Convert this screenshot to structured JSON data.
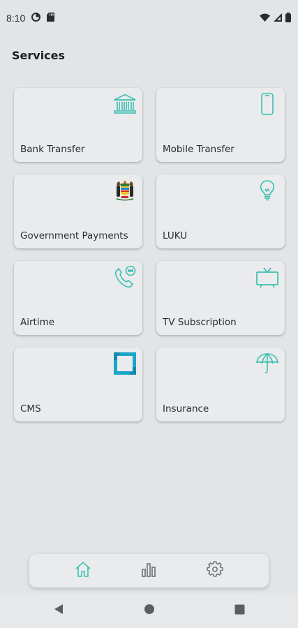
{
  "status_bar": {
    "time": "8:10",
    "left_icons": [
      "data-saver-icon",
      "sd-card-icon"
    ],
    "right_icons": [
      "wifi-icon",
      "cell-signal-icon",
      "battery-icon"
    ]
  },
  "page": {
    "title": "Services"
  },
  "services": [
    {
      "label": "Bank Transfer",
      "icon": "bank-icon"
    },
    {
      "label": "Mobile Transfer",
      "icon": "mobile-phone-icon"
    },
    {
      "label": "Government Payments",
      "icon": "coat-of-arms-icon"
    },
    {
      "label": "LUKU",
      "icon": "light-bulb-icon"
    },
    {
      "label": "Airtime",
      "icon": "phone-call-icon"
    },
    {
      "label": "TV Subscription",
      "icon": "tv-icon"
    },
    {
      "label": "CMS",
      "icon": "cms-logo-icon"
    },
    {
      "label": "Insurance",
      "icon": "umbrella-icon"
    }
  ],
  "bottom_nav": {
    "items": [
      {
        "icon": "home-icon",
        "active": true
      },
      {
        "icon": "bar-chart-icon",
        "active": false
      },
      {
        "icon": "gear-icon",
        "active": false
      }
    ]
  },
  "system_nav": [
    "back-icon",
    "home-circle-icon",
    "recents-icon"
  ],
  "colors": {
    "background": "#e2e5e8",
    "card": "#e9ebed",
    "accent_teal": "#3dbfb0",
    "icon_gray": "#6b6f73"
  }
}
